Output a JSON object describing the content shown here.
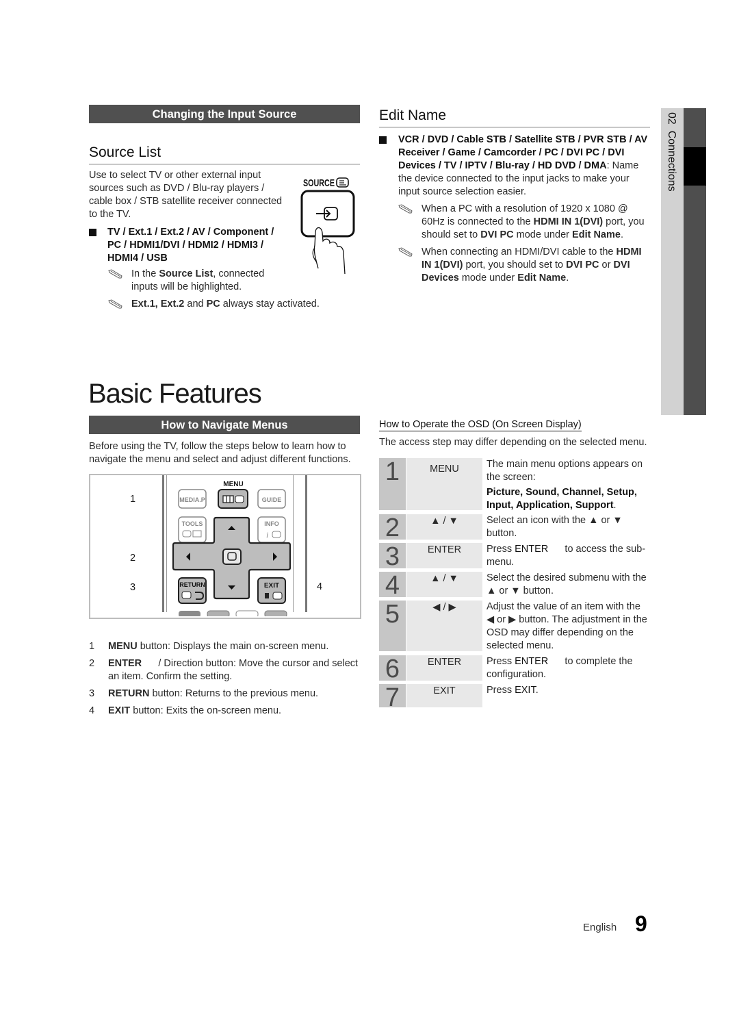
{
  "input_source": {
    "banner": "Changing the Input Source",
    "source_list": {
      "title": "Source List",
      "description": "Use to select TV or other external input sources such as DVD / Blu-ray players / cable box / STB satellite receiver connected to the TV.",
      "bullet": "TV / Ext.1 / Ext.2 / AV / Component / PC / HDMI1/DVI / HDMI2 / HDMI3 / HDMI4 / USB",
      "notes": [
        {
          "pre": "In the ",
          "bold": "Source List",
          "post": ", connected inputs will be highlighted."
        },
        {
          "bold1": "Ext.1, Ext.2",
          "mid": " and ",
          "bold2": "PC",
          "post": " always stay activated."
        }
      ],
      "source_button_label": "SOURCE"
    },
    "edit_name": {
      "title": "Edit Name",
      "bullet_bold": "VCR / DVD / Cable STB / Satellite STB / PVR STB / AV Receiver / Game / Camcorder / PC / DVI PC / DVI Devices / TV / IPTV / Blu-ray / HD DVD / DMA",
      "bullet_rest": ": Name the device connected to the input jacks to make your input source selection easier.",
      "note1": {
        "a": "When a PC with a resolution of 1920 x 1080 @ 60Hz is connected to the ",
        "b": "HDMI IN 1(DVI)",
        "c": " port, you should set to ",
        "d": "DVI PC",
        "e": " mode under ",
        "f": "Edit Name",
        "g": "."
      },
      "note2": {
        "a": "When connecting an HDMI/DVI cable to the ",
        "b": "HDMI IN 1(DVI)",
        "c": " port, you should set to ",
        "d": "DVI PC",
        "e": " or ",
        "f": "DVI Devices",
        "g": " mode under ",
        "h": "Edit Name",
        "i": "."
      }
    }
  },
  "side_tab": {
    "chapter": "02",
    "label": "Connections"
  },
  "basic_features": {
    "title": "Basic Features",
    "navigate": {
      "banner": "How to Navigate Menus",
      "intro": "Before using the TV, follow the steps below to learn how to navigate the menu and select and adjust different functions.",
      "remote": {
        "callouts": [
          "1",
          "2",
          "3",
          "4"
        ],
        "buttons": {
          "menu": "MENU",
          "media": "MEDIA.P",
          "guide": "GUIDE",
          "tools": "TOOLS",
          "info": "INFO",
          "return": "RETURN",
          "exit": "EXIT"
        }
      },
      "list": [
        {
          "n": "1",
          "bold": "MENU",
          "text": " button: Displays the main on-screen menu."
        },
        {
          "n": "2",
          "bold": "ENTER",
          "text": "      / Direction button: Move the cursor and select an item. Confirm the setting."
        },
        {
          "n": "3",
          "bold": "RETURN",
          "text": " button: Returns to the previous menu."
        },
        {
          "n": "4",
          "bold": "EXIT",
          "text": " button: Exits the on-screen menu."
        }
      ]
    },
    "osd": {
      "heading": "How to Operate the OSD (On Screen Display)",
      "intro": "The access step may differ depending on the selected menu.",
      "steps": [
        {
          "n": "1",
          "key": "MENU",
          "desc": "The main menu options appears on the screen:",
          "extra_bold": "Picture, Sound, Channel, Setup, Input, Application, Support",
          "extra_end": "."
        },
        {
          "n": "2",
          "key": "▲ / ▼",
          "desc": "Select an icon with the ▲ or ▼ button."
        },
        {
          "n": "3",
          "key": "ENTER",
          "desc_pre": "Press ",
          "desc_bold": "ENTER",
          "desc": "      to access the sub-menu."
        },
        {
          "n": "4",
          "key": "▲ / ▼",
          "desc": "Select the desired submenu with the ▲ or ▼ button."
        },
        {
          "n": "5",
          "key": "◀ / ▶",
          "desc": "Adjust the value of an item with the ◀ or ▶ button. The adjustment in the OSD may differ depending on the selected menu."
        },
        {
          "n": "6",
          "key": "ENTER",
          "desc_pre": "Press ",
          "desc_bold": "ENTER",
          "desc": "      to complete the configuration."
        },
        {
          "n": "7",
          "key": "EXIT",
          "desc_pre": "Press ",
          "desc_bold": "EXIT",
          "desc": "."
        }
      ]
    }
  },
  "footer": {
    "language": "English",
    "page_number": "9"
  }
}
